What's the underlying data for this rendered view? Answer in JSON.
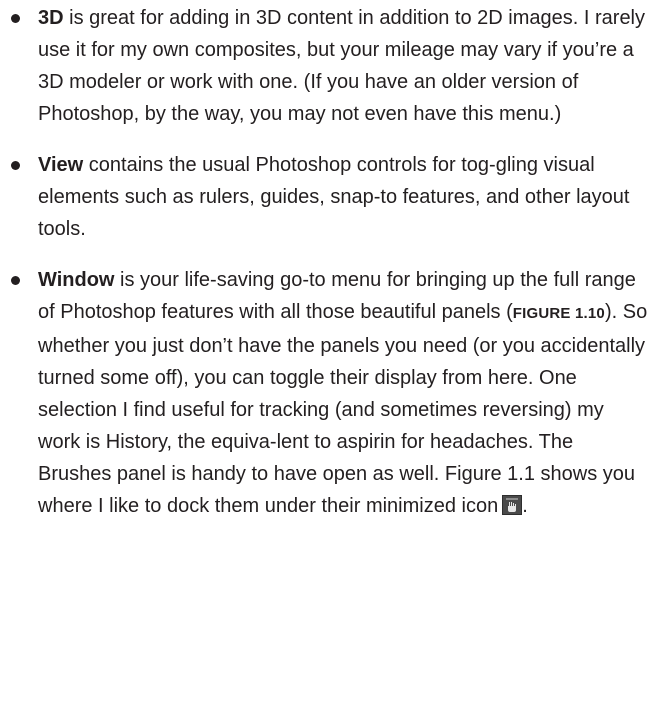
{
  "items": [
    {
      "term": "3D",
      "text": " is great for adding in 3D content in addition to 2D images. I rarely use it for my own composites, but your mileage may vary if you’re a 3D modeler or work with one. (If you have an older version of Photoshop, by the way, you may not even have this menu.)"
    },
    {
      "term": "View",
      "text": " contains the usual Photoshop controls for tog-gling visual elements such as rulers, guides, snap-to features, and other layout tools."
    },
    {
      "term": "Window",
      "text_before": " is your life-saving go-to menu for bringing up the full range of Photoshop features with all those beautiful panels (",
      "figref": "FIGURE 1.10",
      "text_after": "). So whether you just don’t have the panels you need (or you accidentally turned some off), you can toggle their display from here. One selection I find useful for tracking (and sometimes reversing) my work is History, the equiva-lent to aspirin for headaches. The Brushes panel is handy to have open as well. Figure 1.1 shows you where I like to dock them under their minimized icon",
      "icon_name": "brush-panel-icon",
      "text_end": "."
    }
  ]
}
